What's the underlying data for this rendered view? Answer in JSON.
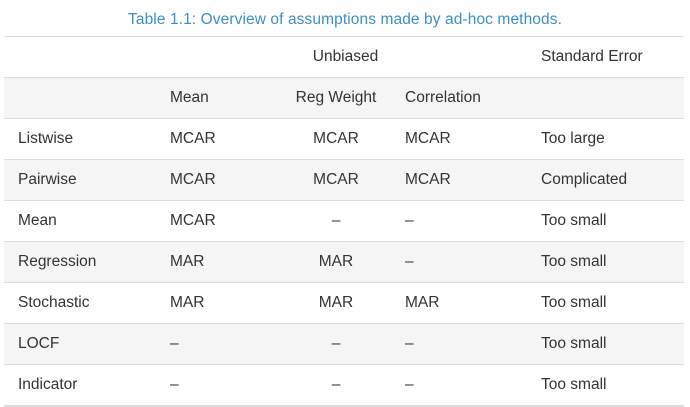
{
  "caption": "Table 1.1: Overview of assumptions made by ad-hoc methods.",
  "header": {
    "group": "Unbiased",
    "standard_error": "Standard Error",
    "sub": [
      "Mean",
      "Reg Weight",
      "Correlation"
    ]
  },
  "rows": [
    {
      "method": "Listwise",
      "mean": "MCAR",
      "reg_weight": "MCAR",
      "correlation": "MCAR",
      "se": "Too large"
    },
    {
      "method": "Pairwise",
      "mean": "MCAR",
      "reg_weight": "MCAR",
      "correlation": "MCAR",
      "se": "Complicated"
    },
    {
      "method": "Mean",
      "mean": "MCAR",
      "reg_weight": "–",
      "correlation": "–",
      "se": "Too small"
    },
    {
      "method": "Regression",
      "mean": "MAR",
      "reg_weight": "MAR",
      "correlation": "–",
      "se": "Too small"
    },
    {
      "method": "Stochastic",
      "mean": "MAR",
      "reg_weight": "MAR",
      "correlation": "MAR",
      "se": "Too small"
    },
    {
      "method": "LOCF",
      "mean": "–",
      "reg_weight": "–",
      "correlation": "–",
      "se": "Too small"
    },
    {
      "method": "Indicator",
      "mean": "–",
      "reg_weight": "–",
      "correlation": "–",
      "se": "Too small"
    }
  ]
}
